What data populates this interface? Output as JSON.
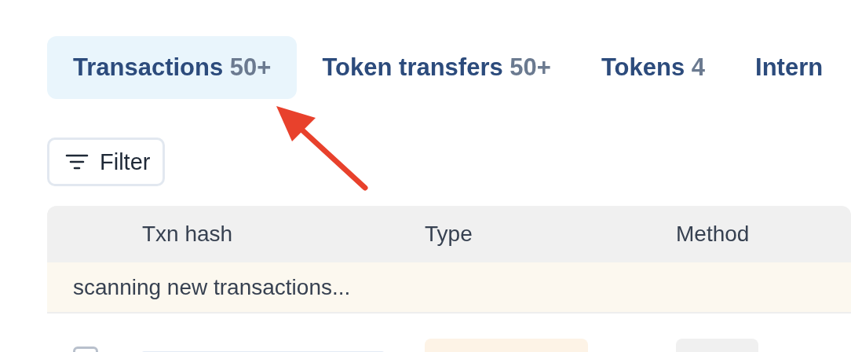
{
  "tabs": [
    {
      "label": "Transactions",
      "count": "50+",
      "selected": true
    },
    {
      "label": "Token transfers",
      "count": "50+",
      "selected": false
    },
    {
      "label": "Tokens",
      "count": "4",
      "selected": false
    },
    {
      "label": "Intern",
      "selected": false
    }
  ],
  "filter_button": {
    "label": "Filter"
  },
  "table": {
    "columns": [
      "Txn hash",
      "Type",
      "Method"
    ],
    "notice": "scanning new transactions...",
    "rows": [
      {
        "checked": false
      }
    ]
  }
}
